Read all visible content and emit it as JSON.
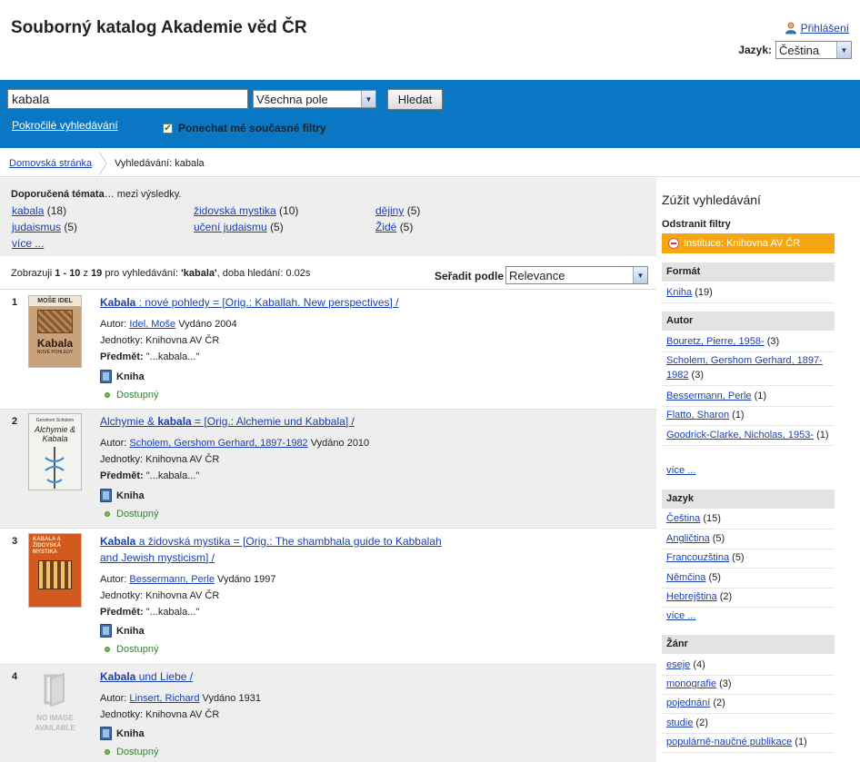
{
  "header": {
    "title": "Souborný katalog Akademie věd ČR",
    "login": "Přihlášení",
    "language_label": "Jazyk:",
    "language_value": "Čeština"
  },
  "search": {
    "query": "kabala",
    "field": "Všechna pole",
    "button": "Hledat",
    "advanced": "Pokročilé vyhledávání",
    "keep_filters": "Ponechat mé současné filtry"
  },
  "breadcrumb": {
    "home": "Domovská stránka",
    "current": "Vyhledávání: kabala"
  },
  "topics": {
    "heading_bold": "Doporučená témata",
    "heading_rest": "… mezi výsledky.",
    "items": [
      {
        "label": "kabala",
        "count": "(18)"
      },
      {
        "label": "židovská mystika",
        "count": "(10)"
      },
      {
        "label": "dějiny",
        "count": "(5)"
      },
      {
        "label": "judaismus",
        "count": "(5)"
      },
      {
        "label": "učení judaismu",
        "count": "(5)"
      },
      {
        "label": "Židé",
        "count": "(5)"
      }
    ],
    "more": "více ..."
  },
  "results_bar": {
    "prefix": "Zobrazuji ",
    "range": "1 - 10",
    "mid": " z ",
    "total": "19",
    "suffix1": " pro vyhledávání: ",
    "query": "'kabala'",
    "suffix2": ", doba hledání: 0.02s",
    "sort_label": "Seřadit podle",
    "sort_value": "Relevance"
  },
  "results": [
    {
      "num": "1",
      "title_bold": "Kabala",
      "title_rest": " : nové pohledy = [Orig.: Kaballah. New perspectives] /",
      "title_rest2": "",
      "author_label": "Autor: ",
      "author": "Idel, Moše",
      "published": " Vydáno 2004",
      "units": "Jednotky: Knihovna AV ČR",
      "subject_label": "Předmět:",
      "subject": " \"...kabala...\"",
      "format": "Kniha",
      "availability": "Dostupný",
      "cover_text_top": "MOŠE IDEL",
      "cover_text_main": "Kabala",
      "cover_text_sub": "NOVÉ POHLEDY"
    },
    {
      "num": "2",
      "title_pre": "Alchymie & ",
      "title_bold": "kabala",
      "title_rest": " = [Orig.: Alchemie und Kabbala] /",
      "author_label": "Autor: ",
      "author": "Scholem, Gershom Gerhard, 1897-1982",
      "published": " Vydáno 2010",
      "units": "Jednotky: Knihovna AV ČR",
      "subject_label": "Předmět:",
      "subject": " \"...kabala...\"",
      "format": "Kniha",
      "availability": "Dostupný",
      "cover_text_top": "Gershom Scholem",
      "cover_text_main": "Alchymie & Kabala"
    },
    {
      "num": "3",
      "title_bold": "Kabala",
      "title_rest": " a židovská mystika = [Orig.: The shambhala guide to Kabbalah",
      "title_rest2": "and Jewish mysticism] /",
      "author_label": "Autor: ",
      "author": "Bessermann, Perle",
      "published": " Vydáno 1997",
      "units": "Jednotky: Knihovna AV ČR",
      "subject_label": "Předmět:",
      "subject": " \"...kabala...\"",
      "format": "Kniha",
      "availability": "Dostupný",
      "cover_text_main": "KABALA A ŽIDOVSKÁ MYSTIKA"
    },
    {
      "num": "4",
      "title_bold": "Kabala",
      "title_rest": " und Liebe /",
      "author_label": "Autor: ",
      "author": "Linsert, Richard",
      "published": " Vydáno 1931",
      "units": "Jednotky: Knihovna AV ČR",
      "format": "Kniha",
      "availability": "Dostupný",
      "no_image": "NO IMAGE AVAILABLE"
    }
  ],
  "sidebar": {
    "title": "Zúžit vyhledávání",
    "remove_filters": "Odstranit filtry",
    "active_filter": "Instituce: Knihovna AV ČR",
    "facets": [
      {
        "name": "Formát",
        "items": [
          {
            "label": "Kniha",
            "count": "(19)"
          }
        ]
      },
      {
        "name": "Autor",
        "items": [
          {
            "label": "Bouretz, Pierre, 1958-",
            "count": "(3)"
          },
          {
            "label": "Scholem, Gershom Gerhard, 1897-1982",
            "count": "(3)"
          },
          {
            "label": "Bessermann, Perle",
            "count": "(1)"
          },
          {
            "label": "Flatto, Sharon",
            "count": "(1)"
          },
          {
            "label": "Goodrick-Clarke, Nicholas, 1953-",
            "count": "(1)"
          },
          {
            "label": "více ...",
            "count": ""
          }
        ]
      },
      {
        "name": "Jazyk",
        "items": [
          {
            "label": "Čeština",
            "count": "(15)"
          },
          {
            "label": "Angličtina",
            "count": "(5)"
          },
          {
            "label": "Francouzština",
            "count": "(5)"
          },
          {
            "label": "Němčina",
            "count": "(5)"
          },
          {
            "label": "Hebrejština",
            "count": "(2)"
          },
          {
            "label": "více ...",
            "count": ""
          }
        ]
      },
      {
        "name": "Žánr",
        "items": [
          {
            "label": "eseje",
            "count": "(4)"
          },
          {
            "label": "monografie",
            "count": "(3)"
          },
          {
            "label": "pojednání",
            "count": "(2)"
          },
          {
            "label": "studie",
            "count": "(2)"
          },
          {
            "label": "populárně-naučné publikace",
            "count": "(1)"
          }
        ]
      }
    ]
  },
  "colors": {
    "band": "#0a77c5",
    "filter": "#f6a612",
    "link": "#1a3fb0",
    "available": "#2a8a2a"
  }
}
